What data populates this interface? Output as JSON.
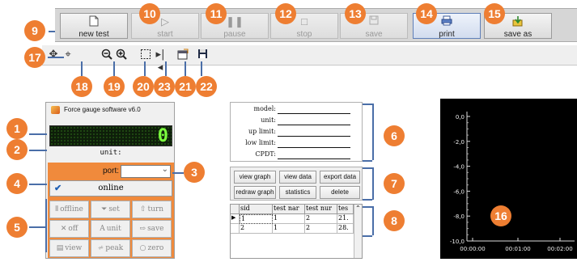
{
  "toolbar": {
    "buttons": [
      {
        "id": "new_test",
        "label": "new test",
        "icon": "document-icon",
        "state": "normal"
      },
      {
        "id": "start",
        "label": "start",
        "icon": "play-icon",
        "state": "disabled"
      },
      {
        "id": "pause",
        "label": "pause",
        "icon": "pause-icon",
        "state": "disabled"
      },
      {
        "id": "stop",
        "label": "stop",
        "icon": "stop-icon",
        "state": "disabled"
      },
      {
        "id": "save",
        "label": "save",
        "icon": "floppy-icon",
        "state": "disabled"
      },
      {
        "id": "print",
        "label": "print",
        "icon": "printer-icon",
        "state": "active"
      },
      {
        "id": "save_as",
        "label": "save as",
        "icon": "save-as-icon",
        "state": "normal"
      }
    ]
  },
  "chart_tools": [
    "move-icon",
    "zoom-cursor-icon",
    "zoom-out-icon",
    "zoom-in-icon",
    "select-box-icon",
    "fit-icon",
    "properties-icon",
    "floppy-icon"
  ],
  "markers": [
    "1",
    "2",
    "3",
    "4",
    "5",
    "6",
    "7",
    "8",
    "9",
    "10",
    "11",
    "12",
    "13",
    "14",
    "15",
    "16",
    "17",
    "18",
    "19",
    "20",
    "21",
    "22",
    "23"
  ],
  "device": {
    "title": "Force gauge software v6.0",
    "lcd_value": "0",
    "unit_label": "unit:",
    "port_label": "port:",
    "port_value": "",
    "online_label": "online",
    "buttons": [
      {
        "label": "offline",
        "icon": "bars-icon"
      },
      {
        "label": "set",
        "icon": "funnel-icon"
      },
      {
        "label": "turn",
        "icon": "turn-icon"
      },
      {
        "label": "off",
        "icon": "x-icon"
      },
      {
        "label": "unit",
        "icon": "letter-a-icon"
      },
      {
        "label": "save",
        "icon": "arrow-right-icon"
      },
      {
        "label": "view",
        "icon": "list-icon"
      },
      {
        "label": "peak",
        "icon": "peak-icon"
      },
      {
        "label": "zero",
        "icon": "circle-icon"
      }
    ]
  },
  "info": {
    "fields": [
      {
        "label": "model:",
        "value": ""
      },
      {
        "label": "unit:",
        "value": ""
      },
      {
        "label": "up limit:",
        "value": ""
      },
      {
        "label": "low limit:",
        "value": ""
      },
      {
        "label": "CPDT:",
        "value": ""
      }
    ]
  },
  "actions": [
    "view graph",
    "view data",
    "export data",
    "redraw graph",
    "statistics",
    "delete"
  ],
  "table": {
    "headers": [
      "sid",
      "test nar",
      "test nur",
      "tes"
    ],
    "rows": [
      [
        "1",
        "1",
        "2",
        "21."
      ],
      [
        "2",
        "1",
        "2",
        "28."
      ]
    ]
  },
  "chart_data": {
    "type": "line",
    "y_ticks": [
      "0,0",
      "-2,0",
      "-4,0",
      "-6,0",
      "-8,0",
      "-10,0"
    ],
    "x_ticks": [
      "00:00:00",
      "00:01:00",
      "00:02:00"
    ],
    "ylim": [
      -10,
      0
    ],
    "series": []
  }
}
